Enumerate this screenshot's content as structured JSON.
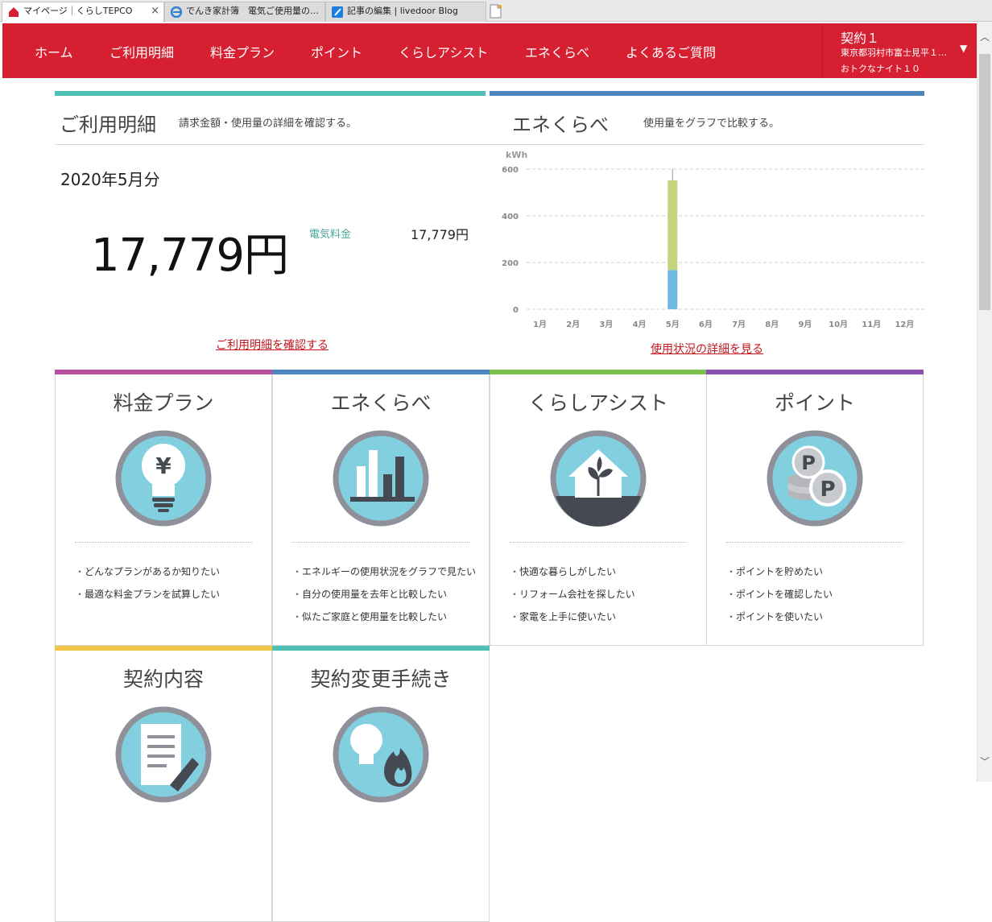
{
  "browser": {
    "tabs": [
      {
        "label": "マイページ｜くらしTEPCO",
        "close": "×"
      },
      {
        "label": "でんき家計簿　電気ご使用量の…"
      },
      {
        "label": "記事の編集 | livedoor Blog"
      }
    ]
  },
  "nav": {
    "items": [
      "ホーム",
      "ご利用明細",
      "料金プラン",
      "ポイント",
      "くらしアシスト",
      "エネくらべ",
      "よくあるご質問"
    ],
    "contract": {
      "title": "契約１",
      "address": "東京都羽村市富士見平１…",
      "plan": "おトクなナイト１０",
      "caret": "▼"
    }
  },
  "billing": {
    "title": "ご利用明細",
    "subtitle": "請求金額・使用量の詳細を確認する。",
    "month": "2020年5月分",
    "amount": "17,779円",
    "electric_label": "電気料金",
    "electric_value": "17,779円",
    "link": "ご利用明細を確認する"
  },
  "usage": {
    "title": "エネくらべ",
    "subtitle": "使用量をグラフで比較する。",
    "link": "使用状況の詳細を見る"
  },
  "chart_data": {
    "type": "bar",
    "stacked": true,
    "ylabel": "kWh",
    "ylim": [
      0,
      600
    ],
    "yticks": [
      0,
      200,
      400,
      600
    ],
    "grid": true,
    "categories": [
      "1月",
      "2月",
      "3月",
      "4月",
      "5月",
      "6月",
      "7月",
      "8月",
      "9月",
      "10月",
      "11月",
      "12月"
    ],
    "series": [
      {
        "color": "#6fb8e3",
        "values": [
          0,
          0,
          0,
          0,
          168,
          0,
          0,
          0,
          0,
          0,
          0,
          0
        ]
      },
      {
        "color": "#c4d47b",
        "values": [
          0,
          0,
          0,
          0,
          384,
          0,
          0,
          0,
          0,
          0,
          0,
          0
        ]
      }
    ]
  },
  "cards": [
    {
      "title": "料金プラン",
      "icon": "bulb-yen-icon",
      "color": "#b84fa0",
      "items": [
        "どんなプランがあるか知りたい",
        "最適な料金プランを試算したい"
      ]
    },
    {
      "title": "エネくらべ",
      "icon": "bar-chart-icon",
      "color": "#4d86bf",
      "items": [
        "エネルギーの使用状況をグラフで見たい",
        "自分の使用量を去年と比較したい",
        "似たご家庭と使用量を比較したい"
      ]
    },
    {
      "title": "くらしアシスト",
      "icon": "house-plant-icon",
      "color": "#7cc04c",
      "items": [
        "快適な暮らしがしたい",
        "リフォーム会社を探したい",
        "家電を上手に使いたい"
      ]
    },
    {
      "title": "ポイント",
      "icon": "point-coins-icon",
      "color": "#8a4fae",
      "items": [
        "ポイントを貯めたい",
        "ポイントを確認したい",
        "ポイントを使いたい"
      ]
    },
    {
      "title": "契約内容",
      "icon": "document-pen-icon",
      "color": "#f0c649",
      "items": []
    },
    {
      "title": "契約変更手続き",
      "icon": "bulb-flame-icon",
      "color": "#4fc1b4",
      "items": []
    }
  ],
  "scrollbar": {
    "up": "︿",
    "down": "﹀"
  }
}
